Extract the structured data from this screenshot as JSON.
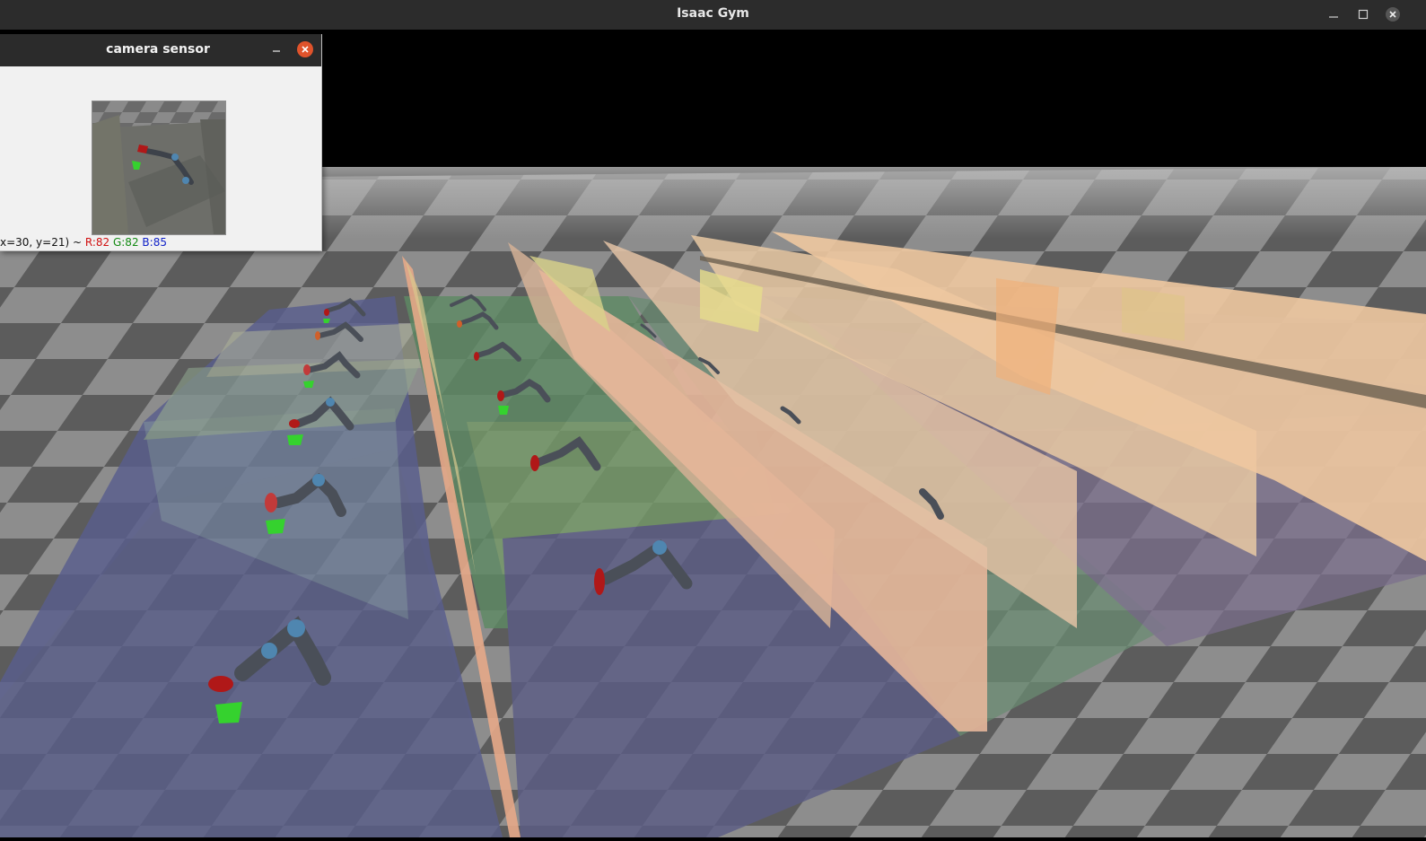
{
  "window": {
    "title": "Isaac Gym",
    "controls": {
      "minimize_icon": "minimize-icon",
      "maximize_icon": "maximize-icon",
      "close_icon": "close-icon"
    }
  },
  "camera_window": {
    "title": "camera sensor",
    "controls": {
      "minimize_icon": "minimize-icon",
      "close_icon": "close-icon"
    },
    "readout": {
      "coords": "x=30, y=21) ~",
      "r": "R:82",
      "g": "G:82",
      "b": "B:85"
    }
  },
  "colors": {
    "titlebar": "#2c2c2c",
    "close_accent": "#e0532b",
    "floor_light": "#8d8d8d",
    "floor_dark": "#5a5a5a",
    "sky": "#000000"
  }
}
